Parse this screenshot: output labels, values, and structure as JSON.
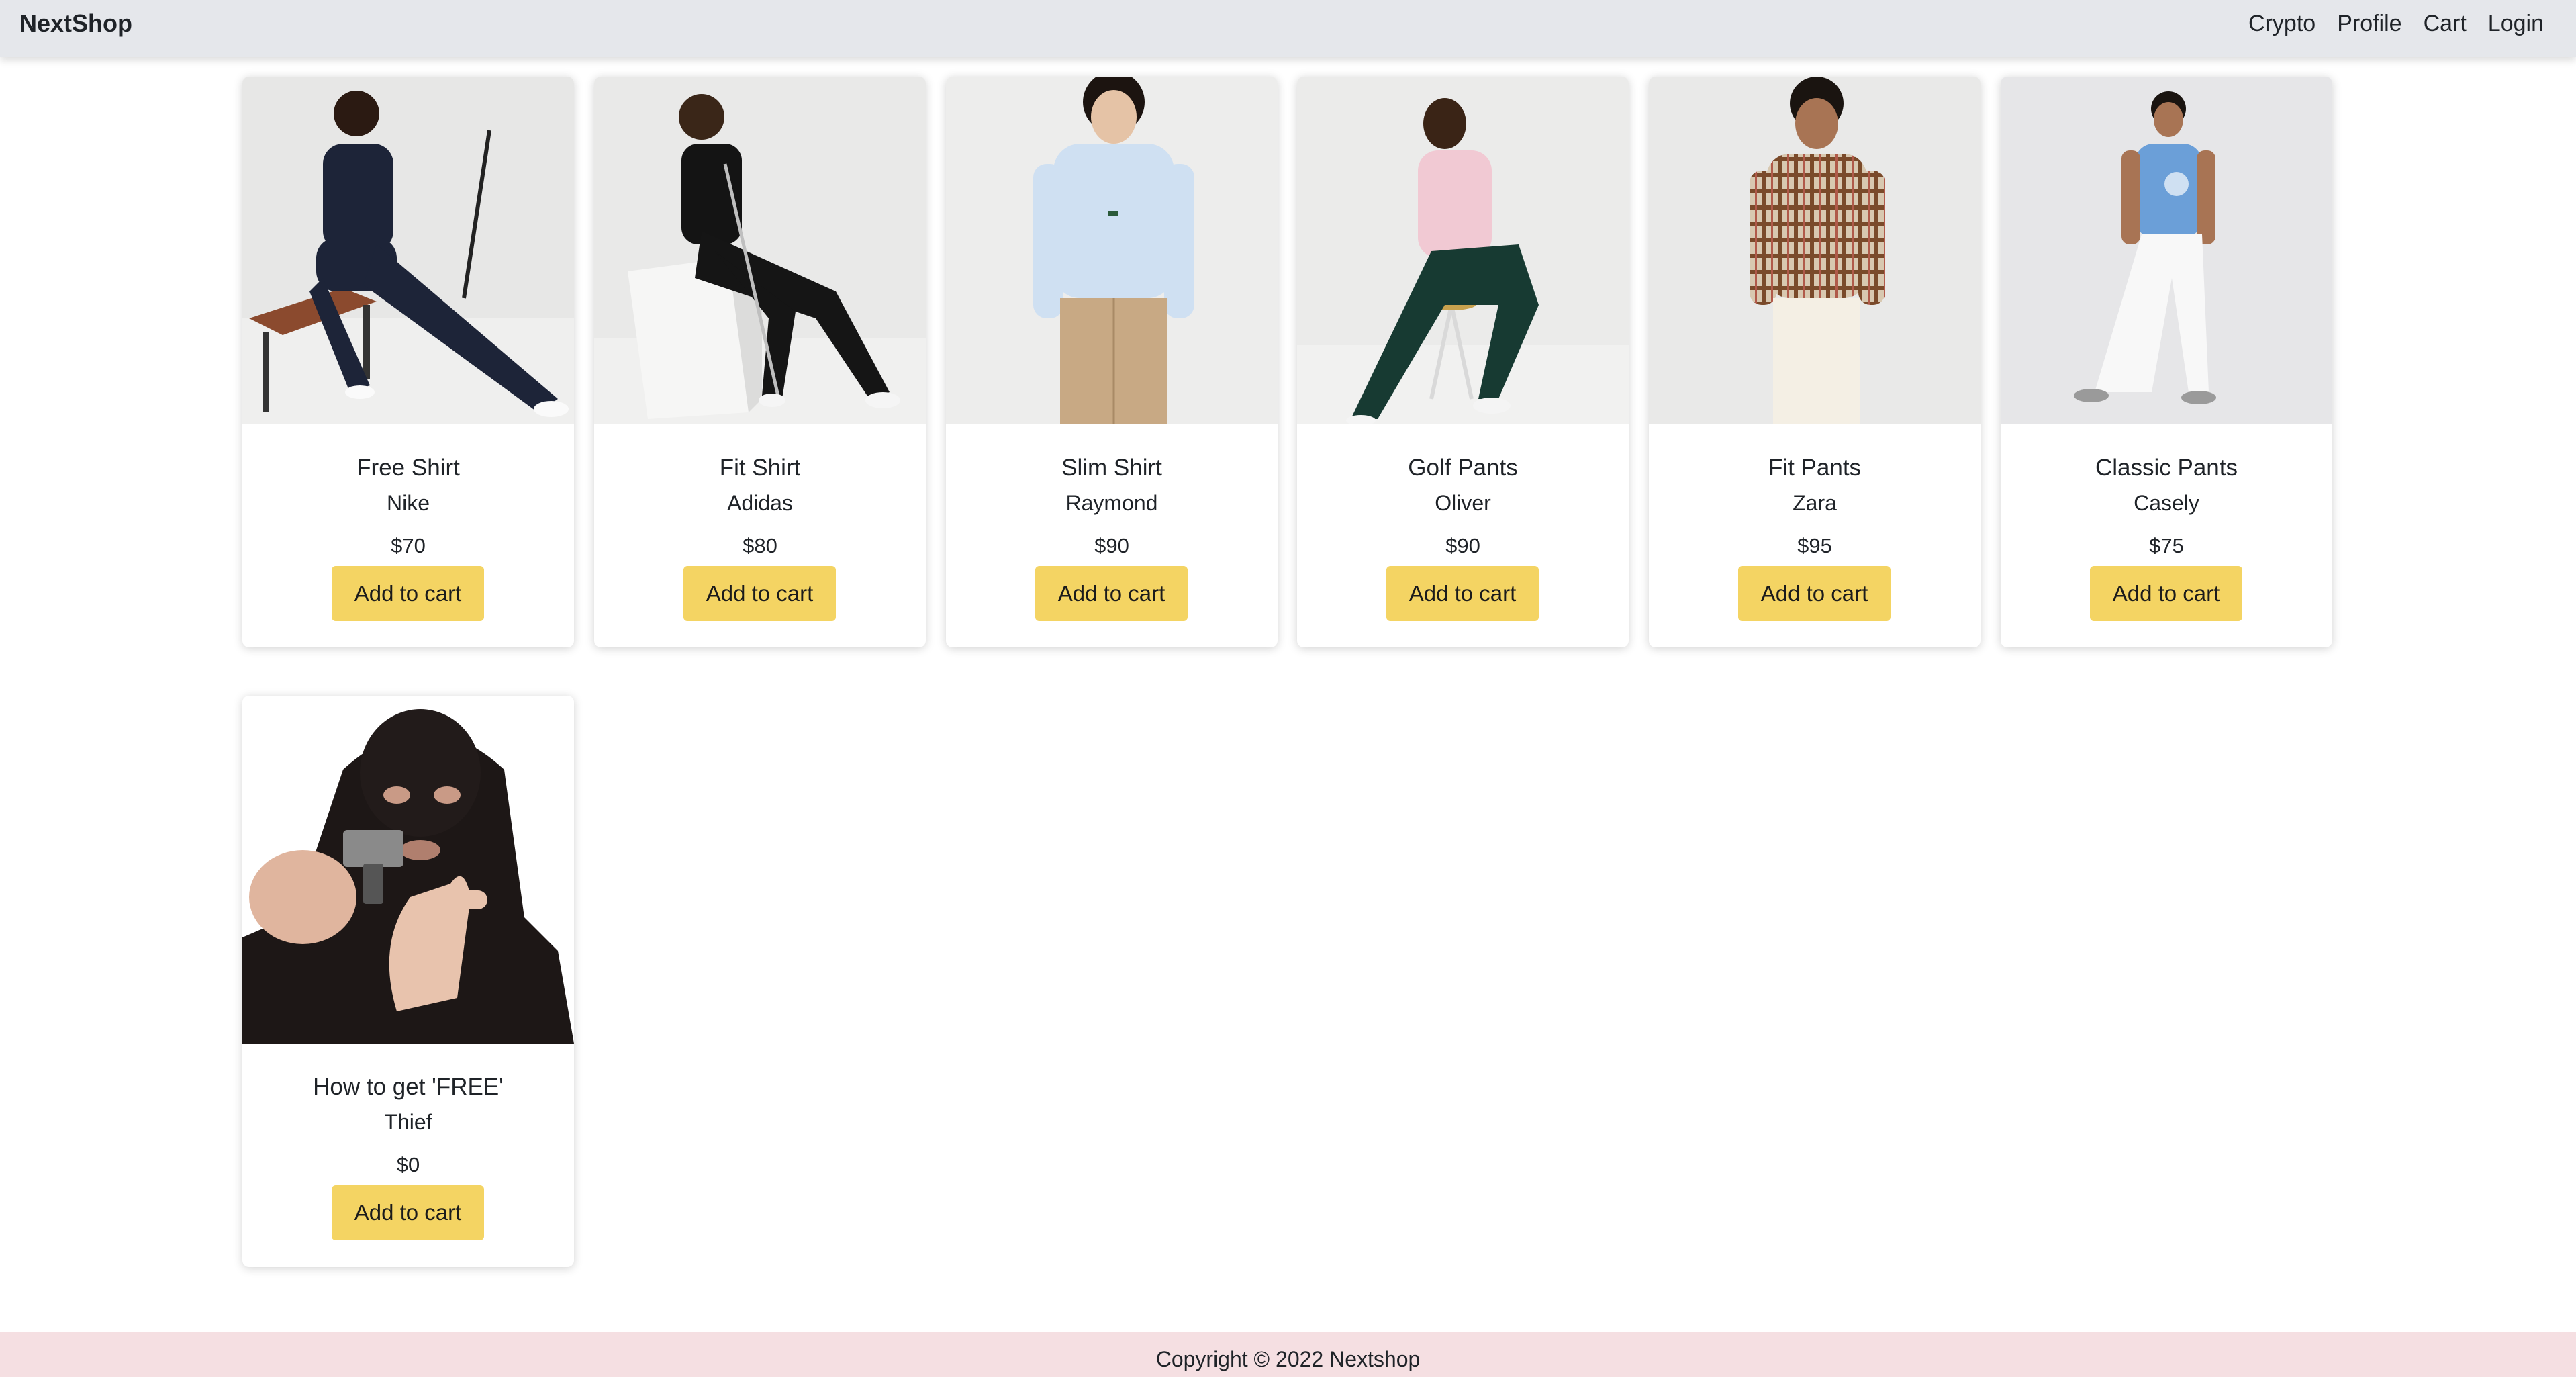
{
  "nav": {
    "brand": "NextShop",
    "links": [
      "Crypto",
      "Profile",
      "Cart",
      "Login"
    ]
  },
  "products": [
    {
      "name": "Free Shirt",
      "brand": "Nike",
      "price": "$70",
      "button": "Add to cart"
    },
    {
      "name": "Fit Shirt",
      "brand": "Adidas",
      "price": "$80",
      "button": "Add to cart"
    },
    {
      "name": "Slim Shirt",
      "brand": "Raymond",
      "price": "$90",
      "button": "Add to cart"
    },
    {
      "name": "Golf Pants",
      "brand": "Oliver",
      "price": "$90",
      "button": "Add to cart"
    },
    {
      "name": "Fit Pants",
      "brand": "Zara",
      "price": "$95",
      "button": "Add to cart"
    },
    {
      "name": "Classic Pants",
      "brand": "Casely",
      "price": "$75",
      "button": "Add to cart"
    },
    {
      "name": "How to get 'FREE'",
      "brand": "Thief",
      "price": "$0",
      "button": "Add to cart"
    }
  ],
  "footer": {
    "text": "Copyright © 2022 Nextshop"
  },
  "colors": {
    "navbar": "#e5e7eb",
    "button": "#f4d463",
    "footer": "#f5dfe2"
  }
}
